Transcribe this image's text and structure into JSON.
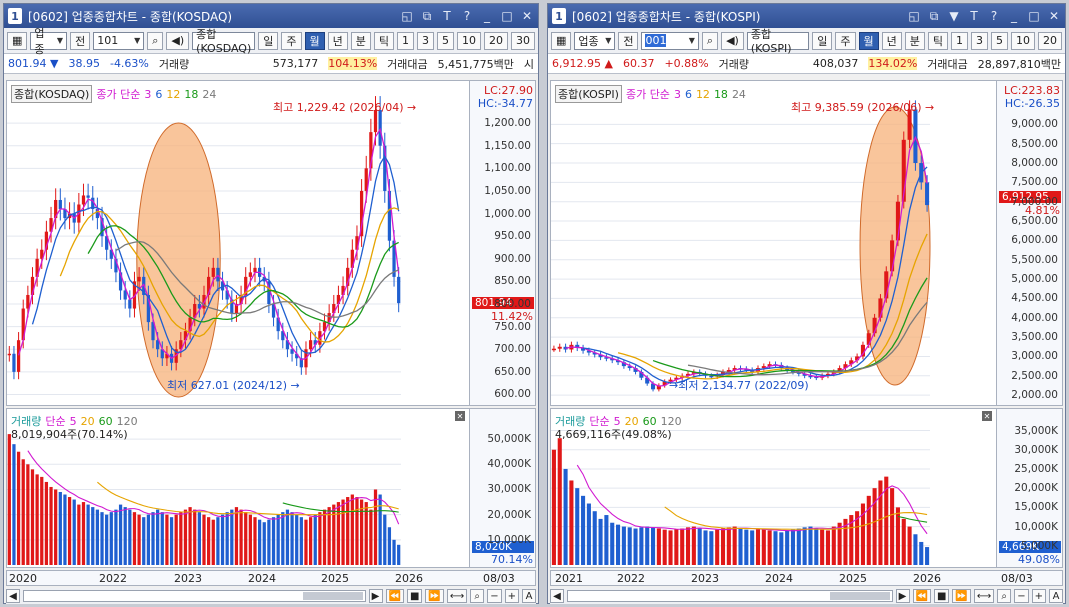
{
  "left": {
    "title": "[0602] 업종종합차트 - 종합(KOSDAQ)",
    "window_controls": [
      "◱",
      "⧉",
      "T",
      "?",
      "_",
      "□",
      "✕"
    ],
    "toolbar": {
      "category": "업종",
      "prev": "전",
      "code": "101",
      "name": "종합(KOSDAQ)",
      "periods": [
        "일",
        "주",
        "월",
        "년",
        "분",
        "틱"
      ],
      "active_period": "월",
      "numbers": [
        "1",
        "3",
        "5",
        "10",
        "20",
        "30"
      ]
    },
    "info": {
      "price": "801.94",
      "change": "38.95",
      "pct": "-4.63%",
      "vol_label": "거래량",
      "volume": "573,177",
      "vol_pct": "104.13%",
      "amt_label": "거래대금",
      "amount": "5,451,775백만",
      "extra": "시"
    },
    "legend": {
      "name": "종합(KOSDAQ)",
      "ma_label": "종가 단순",
      "ma": [
        "3",
        "6",
        "12",
        "18",
        "24"
      ]
    },
    "lc": "LC:27.90",
    "hc": "HC:-34.77",
    "high_ann": "최고 1,229.42 (2026/04)",
    "low_ann": "최저 627.01 (2024/12)",
    "price_ticks": [
      "1,200.00",
      "1,150.00",
      "1,100.00",
      "1,050.00",
      "1,000.00",
      "950.00",
      "900.00",
      "850.00",
      "800.00",
      "750.00",
      "700.00",
      "650.00",
      "600.00"
    ],
    "price_tag": "801.94",
    "price_tag_pct": "11.42%",
    "vol_legend": {
      "label": "거래량",
      "ma_label": "단순",
      "ma": [
        "5",
        "20",
        "60",
        "120"
      ]
    },
    "vol_value": "8,019,904주(70.14%)",
    "vol_ticks": [
      "50,000K",
      "40,000K",
      "30,000K",
      "20,000K",
      "10,000K"
    ],
    "vol_tag": "8,020K",
    "vol_tag_pct": "70.14%",
    "x_labels": [
      "2020",
      "2022",
      "2023",
      "2024",
      "2025",
      "2026",
      "08/03"
    ]
  },
  "right": {
    "title": "[0602] 업종종합차트 - 종합(KOSPI)",
    "window_controls": [
      "◱",
      "⧉",
      "▼",
      "T",
      "?",
      "_",
      "□",
      "✕"
    ],
    "toolbar": {
      "category": "업종",
      "prev": "전",
      "code": "001",
      "name": "종합(KOSPI)",
      "periods": [
        "일",
        "주",
        "월",
        "년",
        "분",
        "틱"
      ],
      "active_period": "월",
      "numbers": [
        "1",
        "3",
        "5",
        "10",
        "20"
      ]
    },
    "info": {
      "price": "6,912.95",
      "change": "60.37",
      "pct": "+0.88%",
      "vol_label": "거래량",
      "volume": "408,037",
      "vol_pct": "134.02%",
      "amt_label": "거래대금",
      "amount": "28,897,810백만"
    },
    "legend": {
      "name": "종합(KOSPI)",
      "ma_label": "종가 단순",
      "ma": [
        "3",
        "6",
        "12",
        "18",
        "24"
      ]
    },
    "lc": "LC:223.83",
    "hc": "HC:-26.35",
    "high_ann": "최고 9,385.59 (2026/06)",
    "low_ann": "최저 2,134.77 (2022/09)",
    "price_ticks": [
      "9,000.00",
      "8,500.00",
      "8,000.00",
      "7,500.00",
      "7,000.00",
      "6,500.00",
      "6,000.00",
      "5,500.00",
      "5,000.00",
      "4,500.00",
      "4,000.00",
      "3,500.00",
      "3,000.00",
      "2,500.00",
      "2,000.00"
    ],
    "price_tag": "6,912.95",
    "price_tag_pct": "4.81%",
    "vol_legend": {
      "label": "거래량",
      "ma_label": "단순",
      "ma": [
        "5",
        "20",
        "60",
        "120"
      ]
    },
    "vol_value": "4,669,116주(49.08%)",
    "vol_ticks": [
      "35,000K",
      "30,000K",
      "25,000K",
      "20,000K",
      "15,000K",
      "10,000K",
      "5,000K"
    ],
    "vol_tag": "4,669K",
    "vol_tag_pct": "49.08%",
    "x_labels": [
      "2021",
      "2022",
      "2023",
      "2024",
      "2025",
      "2026",
      "08/03"
    ]
  },
  "colors": {
    "up": "#e01818",
    "down": "#1f5fd0",
    "highlight": "#f7b27a",
    "ma3": "#d11ad1",
    "ma6": "#1f5fd0",
    "ma12": "#e6a400",
    "ma18": "#1a9a1a",
    "ma24": "#7a7a7a"
  },
  "chart_data": [
    {
      "type": "candlestick",
      "series_name": "종합(KOSDAQ)",
      "x_range": [
        "2020",
        "2026/08"
      ],
      "ylim": [
        590,
        1240
      ],
      "closes": [
        690,
        650,
        720,
        790,
        820,
        860,
        900,
        920,
        960,
        990,
        1030,
        1010,
        990,
        1000,
        980,
        1020,
        1040,
        1035,
        1010,
        990,
        950,
        920,
        900,
        870,
        830,
        810,
        790,
        850,
        860,
        820,
        760,
        720,
        700,
        680,
        690,
        670,
        700,
        720,
        740,
        770,
        800,
        790,
        820,
        860,
        880,
        850,
        830,
        810,
        780,
        800,
        820,
        860,
        870,
        880,
        860,
        850,
        800,
        770,
        740,
        720,
        700,
        690,
        680,
        660,
        700,
        720,
        710,
        740,
        760,
        780,
        800,
        820,
        840,
        880,
        920,
        950,
        1050,
        1100,
        1180,
        1229,
        1150,
        1050,
        940,
        860,
        801.94
      ],
      "volume_k": [
        52000,
        48000,
        45000,
        42000,
        40000,
        38000,
        36000,
        35000,
        33000,
        31000,
        30000,
        29000,
        28000,
        27000,
        26000,
        24000,
        25000,
        24000,
        23000,
        22000,
        21000,
        20000,
        21000,
        22000,
        24000,
        23000,
        22000,
        21000,
        20000,
        19000,
        20000,
        21000,
        22000,
        21000,
        20000,
        19000,
        20000,
        21000,
        22000,
        23000,
        22000,
        21000,
        20000,
        19000,
        18000,
        19000,
        20000,
        21000,
        22000,
        23000,
        22000,
        21000,
        20000,
        19000,
        18000,
        17000,
        18000,
        19000,
        20000,
        21000,
        22000,
        21000,
        20000,
        19000,
        18000,
        19000,
        20000,
        21000,
        22000,
        23000,
        24000,
        25000,
        26000,
        27000,
        28000,
        27000,
        26000,
        25000,
        22000,
        30000,
        28000,
        20000,
        15000,
        10000,
        8020
      ]
    },
    {
      "type": "candlestick",
      "series_name": "종합(KOSPI)",
      "x_range": [
        "2021",
        "2026/08"
      ],
      "ylim": [
        1900,
        9500
      ],
      "closes": [
        3200,
        3250,
        3180,
        3300,
        3220,
        3150,
        3100,
        3050,
        2980,
        2950,
        2900,
        2850,
        2750,
        2700,
        2600,
        2450,
        2300,
        2150,
        2250,
        2350,
        2400,
        2450,
        2500,
        2550,
        2600,
        2550,
        2500,
        2480,
        2520,
        2600,
        2650,
        2700,
        2680,
        2650,
        2600,
        2700,
        2750,
        2800,
        2780,
        2700,
        2650,
        2600,
        2550,
        2500,
        2480,
        2450,
        2500,
        2550,
        2600,
        2700,
        2800,
        2900,
        3000,
        3300,
        3600,
        4000,
        4500,
        5200,
        6000,
        7000,
        8600,
        9385,
        8000,
        7500,
        6912.95
      ],
      "volume_k": [
        30000,
        33000,
        25000,
        22000,
        20000,
        18000,
        16000,
        14000,
        12000,
        13000,
        11000,
        10500,
        10000,
        9800,
        9500,
        9800,
        10000,
        9700,
        9500,
        9200,
        9000,
        9300,
        9500,
        9800,
        10000,
        9500,
        9000,
        8800,
        9200,
        9500,
        9800,
        10000,
        9500,
        9200,
        9000,
        9300,
        9500,
        9000,
        8800,
        8500,
        9000,
        9200,
        9500,
        9800,
        10000,
        9500,
        9200,
        9000,
        10000,
        11000,
        12000,
        13000,
        14000,
        16000,
        18000,
        20000,
        22000,
        23000,
        20000,
        15000,
        12000,
        10000,
        8000,
        6000,
        4669
      ]
    }
  ]
}
